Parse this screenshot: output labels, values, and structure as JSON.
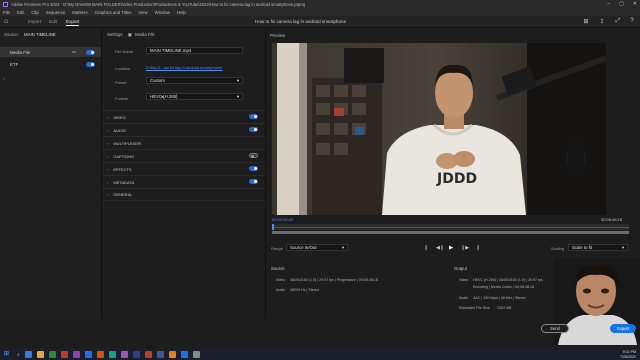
{
  "window": {
    "title": "Adobe Premiere Pro 2022 - D:\\My Drive\\08 MAIN FOLDER\\Video Production\\Productions & YouTube\\2022\\How to fix camera lag in android smartphone.prproj"
  },
  "menu": [
    "File",
    "Edit",
    "Clip",
    "Sequence",
    "Markers",
    "Graphics and Titles",
    "View",
    "Window",
    "Help"
  ],
  "app": {
    "tabs": [
      "Import",
      "Edit",
      "Export"
    ],
    "active_tab": "Export",
    "project_title": "How to fix camera lag in android smartphone"
  },
  "left": {
    "source_label": "Source:",
    "source_value": "MAIN TIMELINE",
    "items": [
      {
        "label": "Media File"
      },
      {
        "label": "ETF"
      }
    ]
  },
  "settings": {
    "header": "Settings",
    "media_file": "Media File",
    "file_name_label": "File Name",
    "file_name": "MAIN TIMELINE.mp4",
    "location_label": "Location",
    "location": "D:\\My D...ow fix lag in android smartphone\\",
    "preset_label": "Preset",
    "preset": "Custom",
    "format_label": "Format",
    "format": "HEVC (H.265)",
    "sections": [
      {
        "label": "VIDEO",
        "toggle": "on"
      },
      {
        "label": "AUDIO",
        "toggle": "on"
      },
      {
        "label": "MULTIPLEXER",
        "toggle": "none"
      },
      {
        "label": "CAPTIONS",
        "toggle": "off"
      },
      {
        "label": "EFFECTS",
        "toggle": "on"
      },
      {
        "label": "METADATA",
        "toggle": "on"
      },
      {
        "label": "GENERAL",
        "toggle": "none"
      }
    ]
  },
  "preview": {
    "label": "Preview",
    "timecode_start": "00;00;00;00",
    "timecode_end": "00;08;48;18",
    "range_label": "Range",
    "range_value": "Source In/Out",
    "scaling_label": "Scaling",
    "scaling_value": "Scale to fit"
  },
  "source": {
    "label": "Source",
    "video_label": "Video",
    "video": "3840x2160 (1.0) | 29.97 fps | Progressive | 00;08;48;18",
    "audio_label": "Audio",
    "audio": "48000 Hz | Stereo"
  },
  "output": {
    "label": "Output",
    "video_label": "Video",
    "video": "HEVC (H.265) | 3840x2160 (1.0) | 29.97 fps",
    "video2": "Encoding | Media Codec | 00;08;48;18",
    "audio_label": "Audio",
    "audio": "AAC | 320 kbps | 48 kHz | Stereo",
    "size_label": "Estimated File Size",
    "size": "1334 MB"
  },
  "buttons": {
    "send": "Send",
    "export": "Export"
  },
  "taskbar": {
    "time": "9:02 PM",
    "date": "7/28/2022",
    "colors": [
      "#3a7bd5",
      "#e8a33d",
      "#2b8a3e",
      "#c0392b",
      "#8e44ad",
      "#1f6feb",
      "#d35400",
      "#16a085",
      "#9b59b6",
      "#2d3e8c",
      "#c0392b",
      "#3b5998",
      "#e67e22",
      "#1a73e8",
      "#7f8c8d"
    ]
  }
}
